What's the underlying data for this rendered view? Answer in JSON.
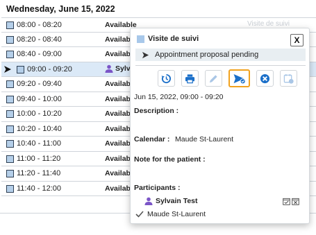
{
  "header": {
    "date": "Wednesday, June 15, 2022"
  },
  "slots": [
    {
      "time": "08:00 - 08:20",
      "status": "Available"
    },
    {
      "time": "08:20 - 08:40",
      "status": "Available"
    },
    {
      "time": "08:40 - 09:00",
      "status": "Available"
    },
    {
      "time": "09:00 - 09:20",
      "status": "Sylvain Test"
    },
    {
      "time": "09:20 - 09:40",
      "status": "Available"
    },
    {
      "time": "09:40 - 10:00",
      "status": "Available"
    },
    {
      "time": "10:00 - 10:20",
      "status": "Available"
    },
    {
      "time": "10:20 - 10:40",
      "status": "Available"
    },
    {
      "time": "10:40 - 11:00",
      "status": "Available"
    },
    {
      "time": "11:00 - 11:20",
      "status": "Available"
    },
    {
      "time": "11:20 - 11:40",
      "status": "Available"
    },
    {
      "time": "11:40 - 12:00",
      "status": "Available"
    }
  ],
  "faded_text": "Visite de suivi",
  "popup": {
    "title": "Visite de suivi",
    "close_label": "X",
    "status_text": "Appointment proposal pending",
    "datetime": "Jun 15, 2022, 09:00 - 09:20",
    "description_label": "Description :",
    "calendar_label": "Calendar :",
    "calendar_value": "Maude St-Laurent",
    "note_label": "Note for the patient :",
    "participants_label": "Participants :",
    "participant_name": "Sylvain Test",
    "calendar_owner": "Maude St-Laurent",
    "toolbar_icons": [
      "history-icon",
      "print-icon",
      "edit-icon",
      "send-proposal-icon",
      "cancel-icon",
      "calendar-check-icon"
    ]
  },
  "colors": {
    "accent_blue": "#1a6fc9",
    "selected_row": "#dbe9f7",
    "active_border": "#f1a21e",
    "participant_purple": "#7b55c7",
    "slot_square": "#b5cfe9"
  }
}
